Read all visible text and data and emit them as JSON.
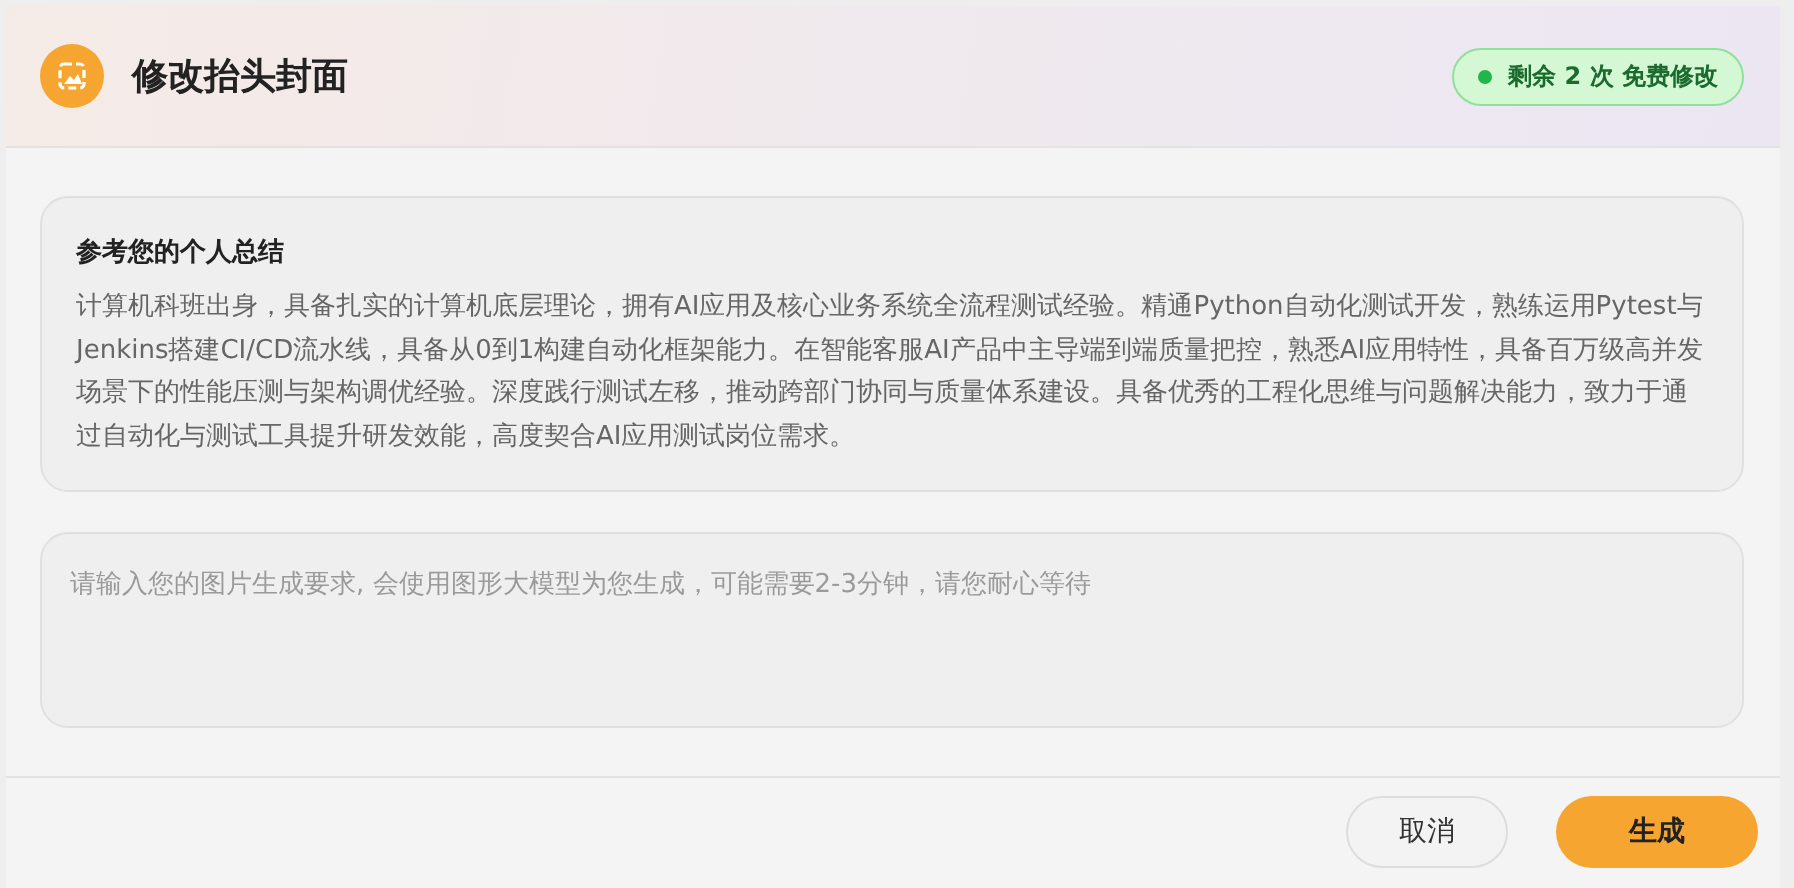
{
  "dialog": {
    "title": "修改抬头封面",
    "badge": "剩余 2 次 免费修改"
  },
  "summary": {
    "heading": "参考您的个人总结",
    "text": "计算机科班出身，具备扎实的计算机底层理论，拥有AI应用及核心业务系统全流程测试经验。精通Python自动化测试开发，熟练运用Pytest与Jenkins搭建CI/CD流水线，具备从0到1构建自动化框架能力。在智能客服AI产品中主导端到端质量把控，熟悉AI应用特性，具备百万级高并发场景下的性能压测与架构调优经验。深度践行测试左移，推动跨部门协同与质量体系建设。具备优秀的工程化思维与问题解决能力，致力于通过自动化与测试工具提升研发效能，高度契合AI应用测试岗位需求。"
  },
  "prompt": {
    "placeholder": "请输入您的图片生成要求, 会使用图形大模型为您生成，可能需要2-3分钟，请您耐心等待"
  },
  "buttons": [
    {
      "label": "取消",
      "kind": "secondary"
    },
    {
      "label": "生成",
      "kind": "primary"
    }
  ]
}
